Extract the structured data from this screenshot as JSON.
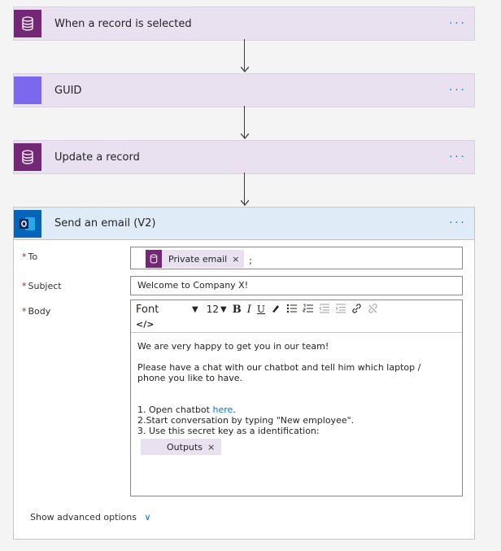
{
  "steps": [
    {
      "title": "When a record is selected",
      "icon": "database-icon",
      "color": "#742774"
    },
    {
      "title": "GUID",
      "icon": "variable-icon",
      "color": "#7b68ee"
    },
    {
      "title": "Update a record",
      "icon": "database-icon",
      "color": "#742774"
    }
  ],
  "more_label": "···",
  "email": {
    "title": "Send an email (V2)",
    "icon": "outlook-icon",
    "to_label": "To",
    "to_token": "Private email",
    "to_suffix": ";",
    "subject_label": "Subject",
    "subject_value": "Welcome to Company X!",
    "body_label": "Body",
    "required_mark": "*",
    "toolbar": {
      "font": "Font",
      "size": "12",
      "dropdown_caret": "▼",
      "bold": "B",
      "italic": "I",
      "underline": "U",
      "code": "</>"
    },
    "body": {
      "line1": "We are very happy to get you in our team!",
      "line2": "Please have a chat with our chatbot and tell him which laptop / phone you like to have.",
      "step1_prefix": "1. Open chatbot ",
      "step1_link": "here",
      "step1_suffix": ".",
      "step2": "2.Start conversation by typing \"New employee\".",
      "step3": "3. Use this secret key as a identification:",
      "outputs_token": "Outputs"
    },
    "token_remove": "×",
    "advanced_label": "Show advanced options",
    "advanced_chevron": "∨"
  },
  "colors": {
    "accent": "#0078d4",
    "purple": "#742774",
    "guid": "#7b68ee",
    "outlook": "#0364b8"
  }
}
